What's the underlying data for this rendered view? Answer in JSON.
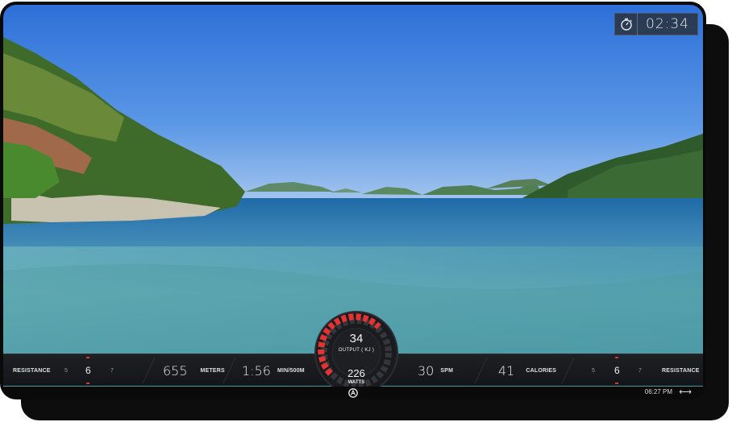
{
  "timer": {
    "icon": "stopwatch-icon",
    "time": "02:34"
  },
  "stats": {
    "resistance_left": {
      "label": "RESISTANCE",
      "prev": "5",
      "current": "6",
      "next": "7"
    },
    "meters": {
      "value": "655",
      "unit": "METERS"
    },
    "pace": {
      "value": "1:56",
      "unit": "MIN/500M"
    },
    "spm": {
      "value": "30",
      "unit": "SPM"
    },
    "calories": {
      "value": "41",
      "unit": "CALORIES"
    },
    "resistance_right": {
      "label": "RESISTANCE",
      "prev": "5",
      "current": "6",
      "next": "7"
    }
  },
  "gauge": {
    "output_value": "34",
    "output_label": "OUTPUT ( KJ )",
    "watts_value": "226",
    "watts_label": "WATTS"
  },
  "footer": {
    "clock": "06:27 PM",
    "expand_icon": "expand-arrows-icon",
    "logo_icon": "brand-logo-icon"
  },
  "colors": {
    "accent_red": "#e53333",
    "bar_bg": "#1a1c1f"
  }
}
